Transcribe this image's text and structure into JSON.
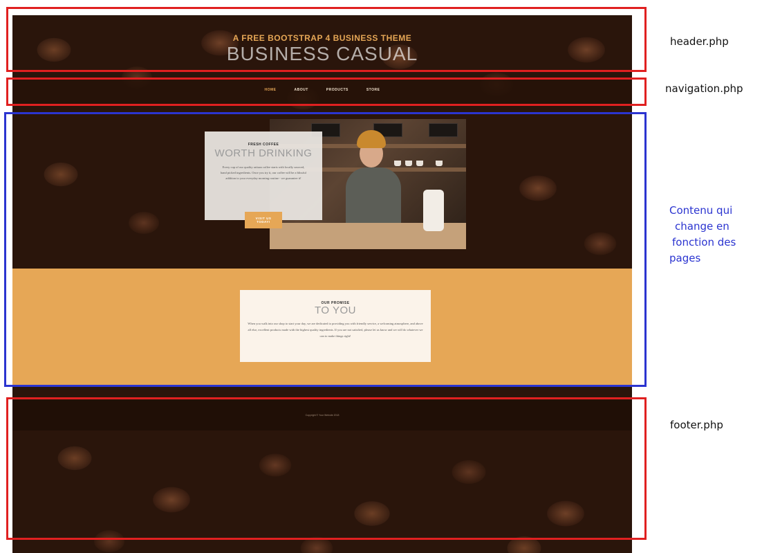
{
  "header": {
    "subtitle": "A FREE BOOTSTRAP 4 BUSINESS THEME",
    "title": "BUSINESS CASUAL"
  },
  "nav": {
    "items": [
      "HOME",
      "ABOUT",
      "PRODUCTS",
      "STORE"
    ],
    "active": "HOME"
  },
  "intro": {
    "upper": "FRESH COFFEE",
    "lower": "WORTH DRINKING",
    "body": "Every cup of our quality artisan coffee starts with locally sourced, hand picked ingredients. Once you try it, our coffee will be a blissful addition to your everyday morning routine - we guarantee it!",
    "button": "Visit Us Today!"
  },
  "promise": {
    "upper": "OUR PROMISE",
    "lower": "TO YOU",
    "body": "When you walk into our shop to start your day, we are dedicated to providing you with friendly service, a welcoming atmosphere, and above all else, excellent products made with the highest quality ingredients. If you are not satisfied, please let us know and we will do whatever we can to make things right!"
  },
  "footer": {
    "copyright": "Copyright © Your Website 2018"
  },
  "annotations": {
    "header": "header.php",
    "navigation": "navigation.php",
    "content": "Contenu qui change en fonction des pages",
    "content_lines": [
      "Contenu qui",
      "change en",
      "fonction des",
      "pages"
    ],
    "footer": "footer.php"
  },
  "colors": {
    "accent": "#e6a756",
    "red_annotation": "#e02020",
    "blue_annotation": "#2b34d0",
    "promise_card": "#fbf3ea"
  }
}
